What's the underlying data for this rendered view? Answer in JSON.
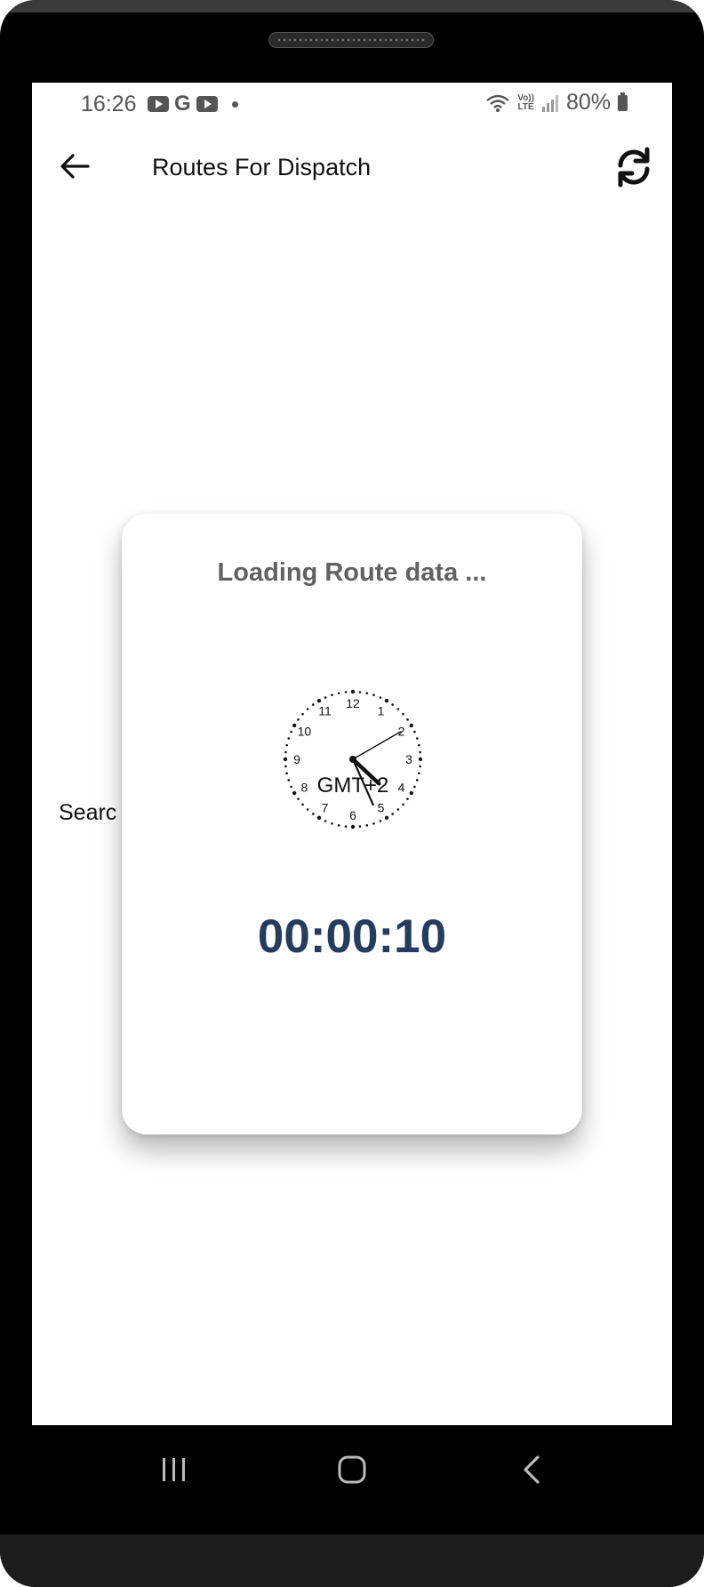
{
  "status_bar": {
    "time": "16:26",
    "notification_icons": [
      "youtube-icon",
      "google-icon",
      "youtube-icon",
      "dot-icon"
    ],
    "lte_label_top": "Vo))",
    "lte_label_bottom": "LTE",
    "battery_percent": "80%"
  },
  "app_bar": {
    "title": "Routes For Dispatch",
    "back_icon": "arrow-left-icon",
    "refresh_icon": "refresh-icon"
  },
  "background": {
    "search_label": "Searc"
  },
  "loading_dialog": {
    "title": "Loading Route data ...",
    "clock": {
      "timezone_label": "GMT+2",
      "numbers": [
        "12",
        "1",
        "2",
        "3",
        "4",
        "5",
        "6",
        "7",
        "8",
        "9",
        "10",
        "11"
      ],
      "hour": 4,
      "minute": 26,
      "second": 10
    },
    "elapsed": "00:00:10"
  },
  "nav_bar": {
    "recents_icon": "recents-icon",
    "home_icon": "home-icon",
    "back_icon": "back-chevron-icon"
  },
  "colors": {
    "timer_color": "#253c5e",
    "title_color": "#616161"
  }
}
